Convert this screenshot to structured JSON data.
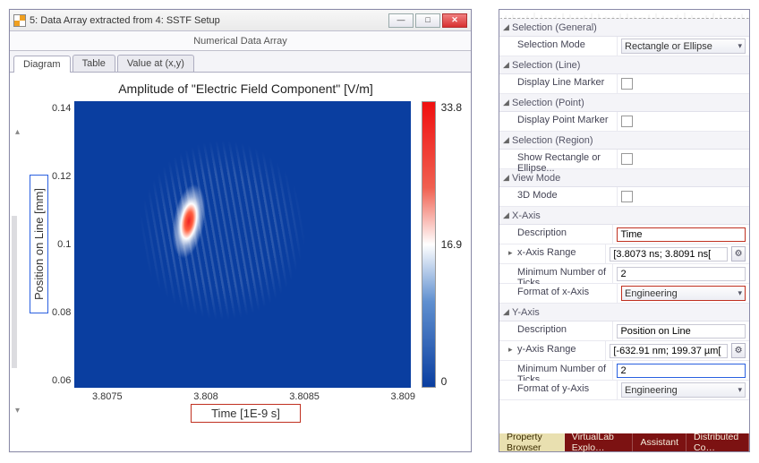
{
  "window": {
    "title": "5: Data Array extracted from 4: SSTF Setup",
    "subtitle": "Numerical Data Array",
    "buttons": {
      "min": "—",
      "max": "□",
      "close": "✕"
    }
  },
  "tabs": [
    "Diagram",
    "Table",
    "Value at (x,y)"
  ],
  "plot": {
    "title": "Amplitude of \"Electric Field Component\"  [V/m]",
    "ylabel": "Position on Line [mm]",
    "xlabel": "Time [1E-9 s]",
    "yticks": [
      "0.14",
      "0.12",
      "0.1",
      "0.08",
      "0.06"
    ],
    "xticks": [
      "3.8075",
      "3.808",
      "3.8085",
      "3.809"
    ],
    "cb": {
      "max": "33.8",
      "mid": "16.9",
      "min": "0"
    }
  },
  "chart_data": {
    "type": "heatmap",
    "title": "Amplitude of \"Electric Field Component\"  [V/m]",
    "xlabel": "Time [1E-9 s]",
    "ylabel": "Position on Line [mm]",
    "x_range": [
      3.8073,
      3.8091
    ],
    "y_range": [
      0.05,
      0.15
    ],
    "xticks": [
      3.8075,
      3.808,
      3.8085,
      3.809
    ],
    "yticks": [
      0.06,
      0.08,
      0.1,
      0.12,
      0.14
    ],
    "colorbar": {
      "min": 0,
      "mid": 16.9,
      "max": 33.8,
      "cmap_low": "#0a3ea0",
      "cmap_mid": "#ffffff",
      "cmap_high": "#f01010"
    },
    "peak": {
      "x": 3.808,
      "y": 0.1,
      "value": 33.8
    },
    "note": "2-D heatmap of |E| vs time and transverse position; tilted elliptical pulse with interference fringes toward larger time."
  },
  "props": {
    "sections": {
      "sel_general": "Selection (General)",
      "sel_line": "Selection (Line)",
      "sel_point": "Selection (Point)",
      "sel_region": "Selection (Region)",
      "view_mode": "View Mode",
      "x_axis": "X-Axis",
      "y_axis": "Y-Axis"
    },
    "rows": {
      "sel_mode_k": "Selection Mode",
      "sel_mode_v": "Rectangle or Ellipse",
      "line_marker_k": "Display Line Marker",
      "point_marker_k": "Display Point Marker",
      "show_rect_k": "Show Rectangle or Ellipse...",
      "threeD_k": "3D Mode",
      "x_desc_k": "Description",
      "x_desc_v": "Time",
      "x_range_k": "x-Axis Range",
      "x_range_v": "[3.8073 ns; 3.8091 ns[",
      "x_ticks_k": "Minimum Number of Ticks",
      "x_ticks_v": "2",
      "x_fmt_k": "Format of x-Axis",
      "x_fmt_v": "Engineering",
      "y_desc_k": "Description",
      "y_desc_v": "Position on Line",
      "y_range_k": "y-Axis Range",
      "y_range_v": "[-632.91 nm; 199.37 µm[",
      "y_ticks_k": "Minimum Number of Ticks",
      "y_ticks_v": "2",
      "y_fmt_k": "Format of y-Axis",
      "y_fmt_v": "Engineering"
    }
  },
  "panel_tabs": [
    "Property Browser",
    "VirtualLab Explo…",
    "Assistant",
    "Distributed Co…"
  ]
}
